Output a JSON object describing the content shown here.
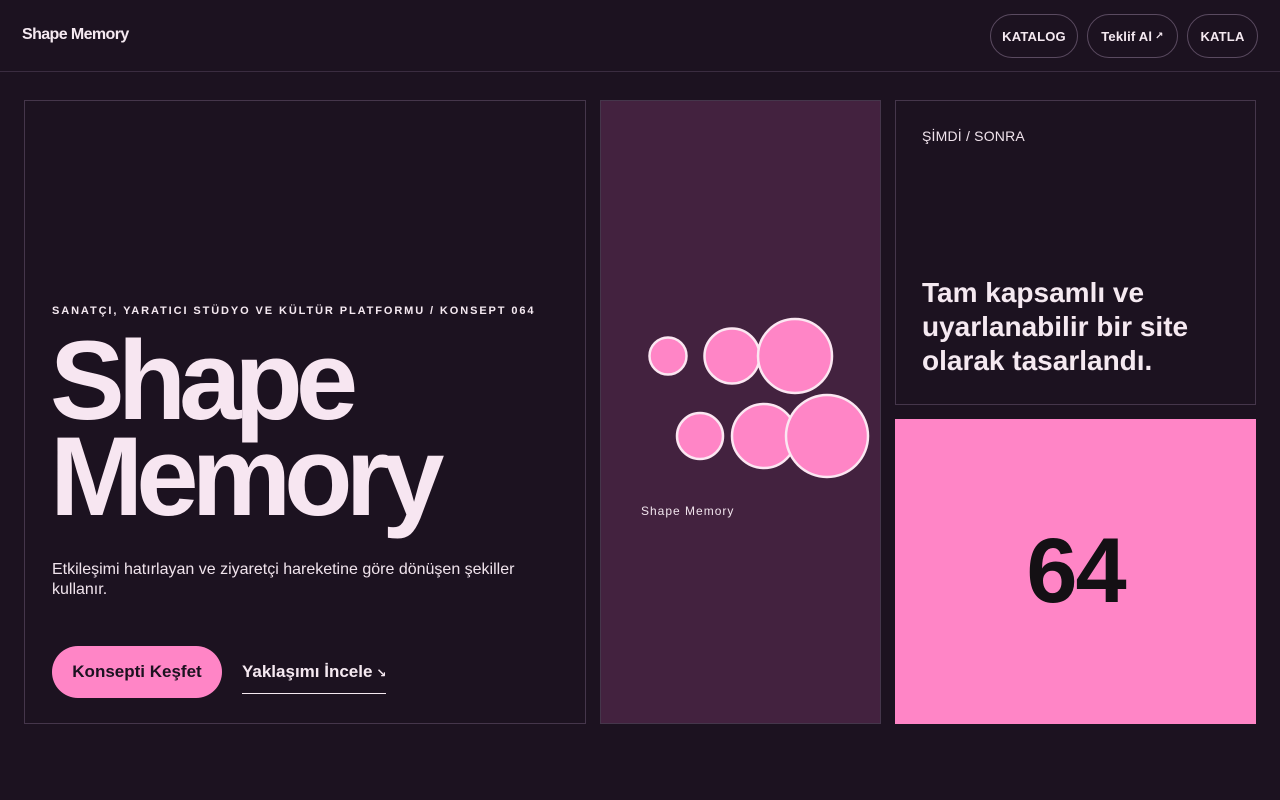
{
  "header": {
    "brand": "Shape Memory",
    "nav": [
      {
        "label": "KATALOG"
      },
      {
        "label": "Teklif Al",
        "icon": "arrow-up-right-icon"
      },
      {
        "label": "KATLA"
      }
    ]
  },
  "hero": {
    "eyebrow": "SANATÇI, YARATICI STÜDYO VE KÜLTÜR PLATFORMU / KONSEPT 064",
    "title_line1": "Shape",
    "title_line2": "Memory",
    "description": "Etkileşimi hatırlayan ve ziyaretçi hareketine göre dönüşen şekiller kullanır.",
    "cta_primary": "Konsepti Keşfet",
    "cta_secondary": "Yaklaşımı İncele",
    "cta_secondary_icon": "arrow-down-right-icon"
  },
  "shapes_panel": {
    "caption": "Shape Memory",
    "shape_color": "#ff85c6",
    "background": "#43223f"
  },
  "statement_card": {
    "label": "ŞİMDİ / SONRA",
    "text": "Tam kapsamlı ve uyarlanabilir bir site olarak tasarlandı."
  },
  "number_card": {
    "value": "64",
    "background": "#ff85c6"
  },
  "colors": {
    "page_background": "#1c1220",
    "accent": "#ff85c6",
    "text": "#f5e9f1"
  }
}
